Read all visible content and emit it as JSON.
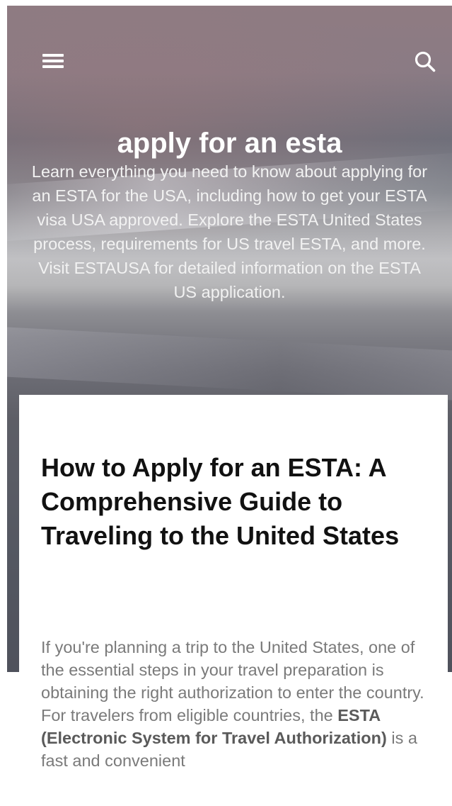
{
  "header": {
    "menu_icon": "hamburger-menu-icon",
    "search_icon": "search-icon",
    "icon_color": "#ffffff"
  },
  "hero": {
    "title": "apply for an esta",
    "description": "Learn everything you need to know about applying for an ESTA for the USA, including how to get your ESTA visa USA approved. Explore the ESTA United States process, requirements for US travel ESTA, and more. Visit ESTAUSA for detailed information on the ESTA US application."
  },
  "article": {
    "title": "How to Apply for an ESTA: A Comprehensive Guide to Traveling to the United States",
    "intro_before": "If you're planning a trip to the United States, one of the essential steps in your travel preparation is obtaining the right authorization to enter the country. For travelers from eligible countries, the ",
    "intro_bold": "ESTA (Electronic System for Travel Authorization)",
    "intro_after": " is a fast and convenient"
  },
  "colors": {
    "card_background": "#ffffff",
    "title_text": "#111111",
    "body_text": "#7a7a7a"
  }
}
